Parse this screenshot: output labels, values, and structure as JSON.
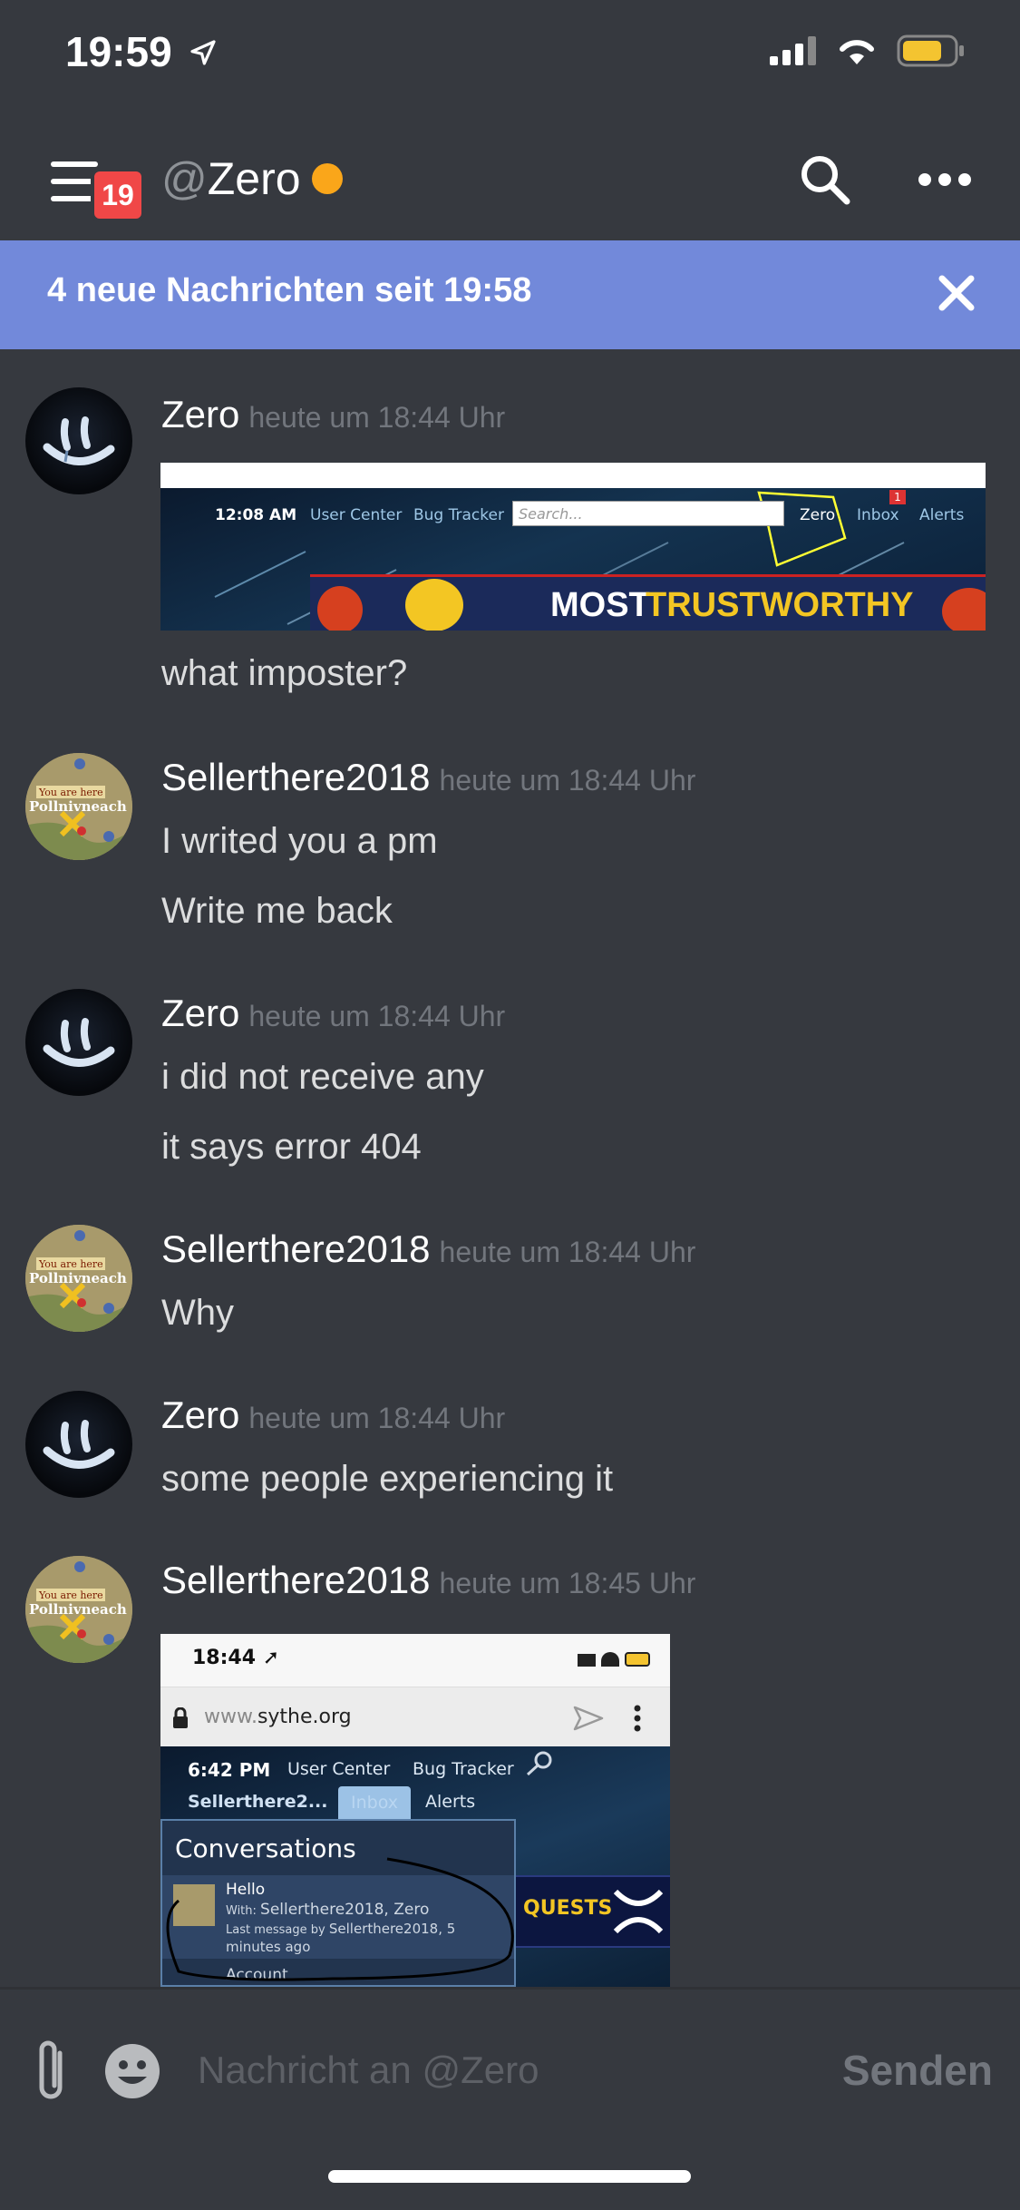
{
  "status_bar": {
    "time": "19:59"
  },
  "header": {
    "badge_count": "19",
    "at_sign": "@",
    "channel_name": "Zero",
    "status_color": "#faa61a"
  },
  "banner": {
    "text": "4 neue Nachrichten seit 19:58"
  },
  "messages": [
    {
      "author": "Zero",
      "timestamp": "heute um 18:44 Uhr",
      "lines": [
        "what imposter?"
      ],
      "embed": {
        "time": "12:08 AM",
        "links": [
          "User Center",
          "Bug Tracker"
        ],
        "search_placeholder": "Search...",
        "user": "Zero",
        "inbox": "Inbox",
        "inbox_count": "1",
        "alerts": "Alerts",
        "banner_word1": "MOST",
        "banner_word2": "TRUSTWORTHY"
      }
    },
    {
      "author": "Sellerthere2018",
      "timestamp": "heute um 18:44 Uhr",
      "lines": [
        "I writed you a pm",
        "Write me back"
      ]
    },
    {
      "author": "Zero",
      "timestamp": "heute um 18:44 Uhr",
      "lines": [
        "i did not receive any",
        "it says error 404"
      ]
    },
    {
      "author": "Sellerthere2018",
      "timestamp": "heute um 18:44 Uhr",
      "lines": [
        "Why"
      ]
    },
    {
      "author": "Zero",
      "timestamp": "heute um 18:44 Uhr",
      "lines": [
        "some people experiencing it"
      ]
    },
    {
      "author": "Sellerthere2018",
      "timestamp": "heute um 18:45 Uhr",
      "lines": [],
      "embed": {
        "phone_time": "18:44",
        "url_prefix": "www.",
        "url_domain": "sythe.org",
        "site_time": "6:42 PM",
        "links": [
          "User Center",
          "Bug Tracker"
        ],
        "user": "Sellerthere2...",
        "inbox": "Inbox",
        "alerts": "Alerts",
        "panel_title": "Conversations",
        "conv_title": "Hello",
        "conv_with_label": "With: ",
        "conv_with": "Sellerthere2018, Zero",
        "conv_last_label": "Last message by ",
        "conv_last": "Sellerthere2018, 5 minutes ago",
        "conv_next": "Account",
        "ad_text": "QUESTS"
      }
    }
  ],
  "avatar_map_label_1": "You are here",
  "avatar_map_label_2": "Pollnivneach",
  "input": {
    "placeholder": "Nachricht an @Zero",
    "send_label": "Senden"
  },
  "colors": {
    "background": "#36393f",
    "banner": "#7289da",
    "badge": "#f04747",
    "timestamp": "#72767d"
  },
  "icons": [
    "location-arrow-icon",
    "cellular-signal-icon",
    "wifi-icon",
    "battery-icon",
    "hamburger-menu-icon",
    "search-icon",
    "more-options-icon",
    "close-icon",
    "paperclip-icon",
    "emoji-icon",
    "lock-icon",
    "share-icon",
    "kebab-icon",
    "magnifier-icon"
  ]
}
